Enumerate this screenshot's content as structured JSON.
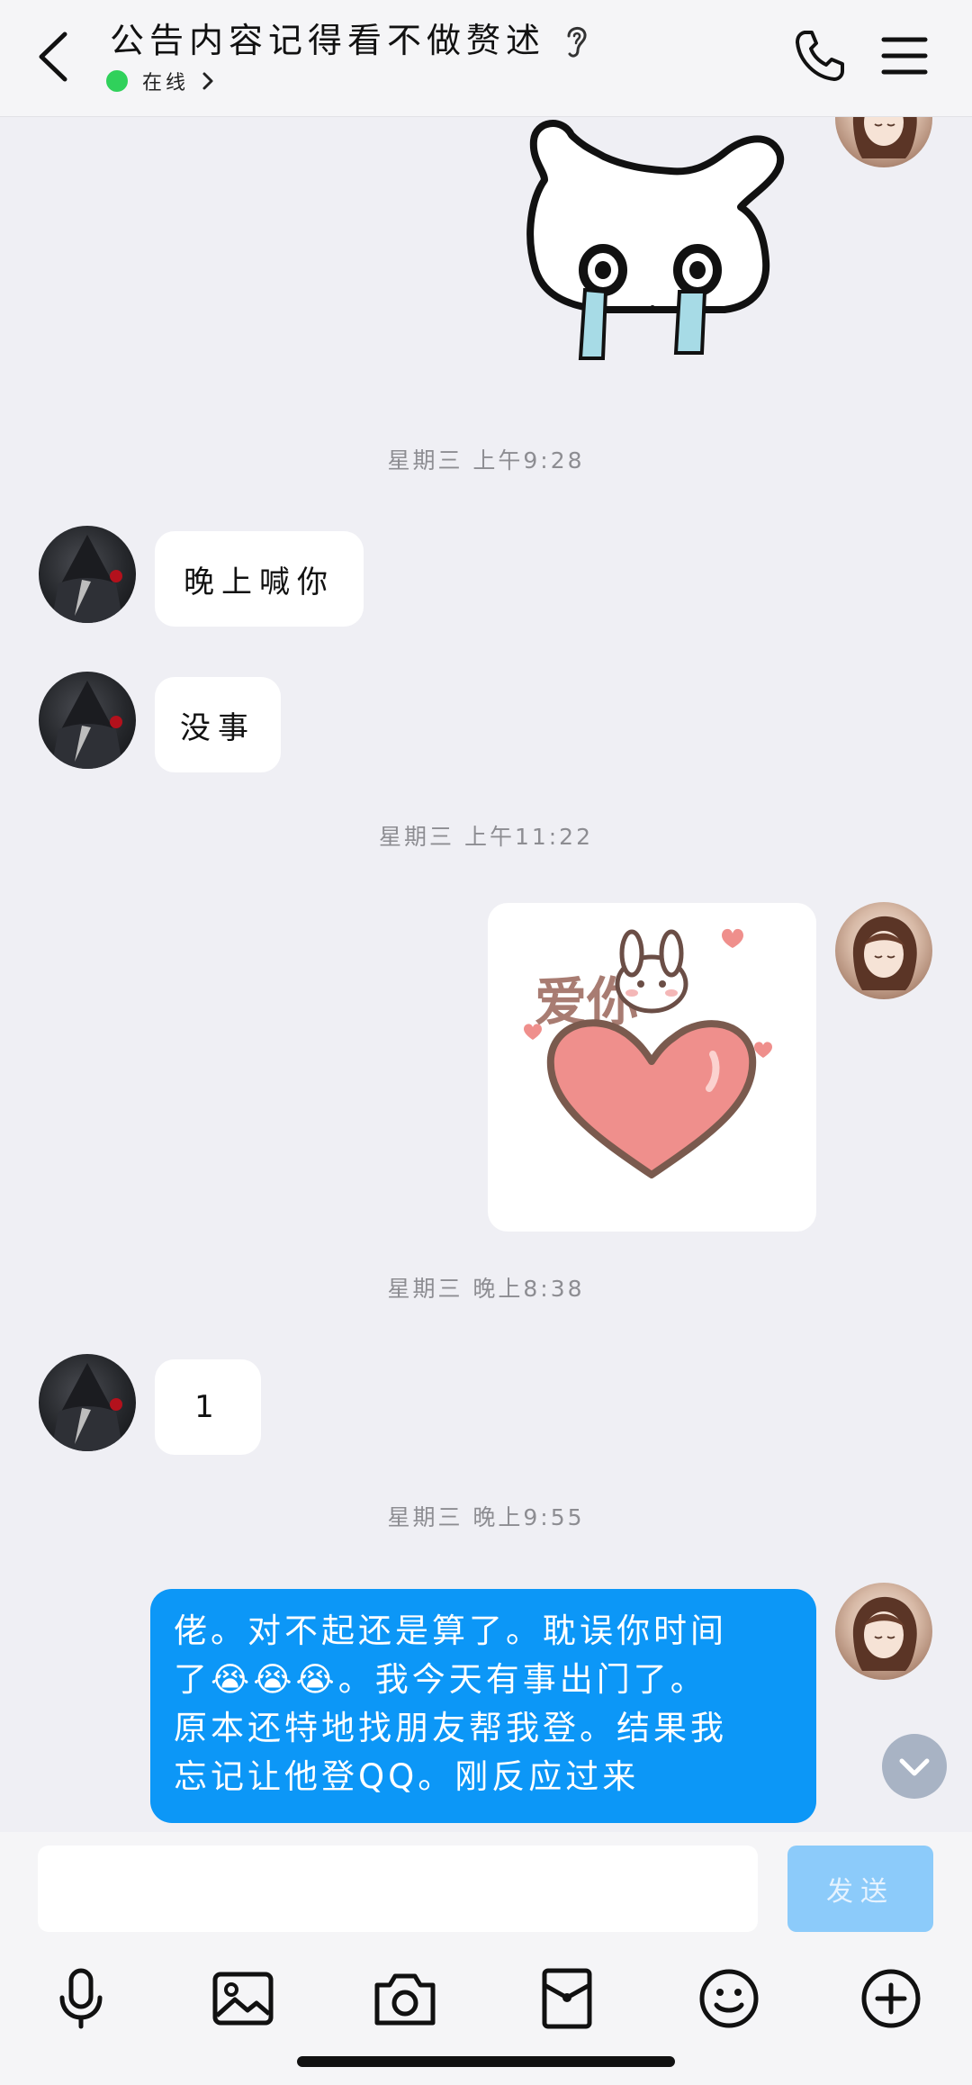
{
  "header": {
    "title": "公告内容记得看不做赘述",
    "status_text": "在线",
    "status_color": "#30d15b"
  },
  "messages": [
    {
      "type": "sticker",
      "side": "self",
      "sticker": "crying-bunny-sticker"
    },
    {
      "type": "timestamp",
      "text": "星期三 上午9:28"
    },
    {
      "type": "text",
      "side": "other",
      "text": "晚上喊你"
    },
    {
      "type": "text",
      "side": "other",
      "text": "没事"
    },
    {
      "type": "timestamp",
      "text": "星期三 上午11:22"
    },
    {
      "type": "sticker",
      "side": "self",
      "sticker": "love-you-bunny-heart-sticker",
      "sticker_text": "爱你"
    },
    {
      "type": "timestamp",
      "text": "星期三 晚上8:38"
    },
    {
      "type": "text",
      "side": "other",
      "text": "1"
    },
    {
      "type": "timestamp",
      "text": "星期三 晚上9:55"
    },
    {
      "type": "text",
      "side": "self",
      "text_lines": [
        "佬。对不起还是算了。耽误你时间",
        "了😭😭😭。我今天有事出门了。",
        "原本还特地找朋友帮我登。结果我",
        "忘记让他登QQ。刚反应过来"
      ]
    }
  ],
  "input": {
    "value": "",
    "send_label": "发送"
  },
  "toolbar": [
    "microphone-icon",
    "image-icon",
    "camera-icon",
    "red-packet-icon",
    "emoji-icon",
    "plus-icon"
  ],
  "colors": {
    "background": "#efeff4",
    "self_bubble": "#0c97f7",
    "send_button_disabled": "#8ccbfa"
  }
}
